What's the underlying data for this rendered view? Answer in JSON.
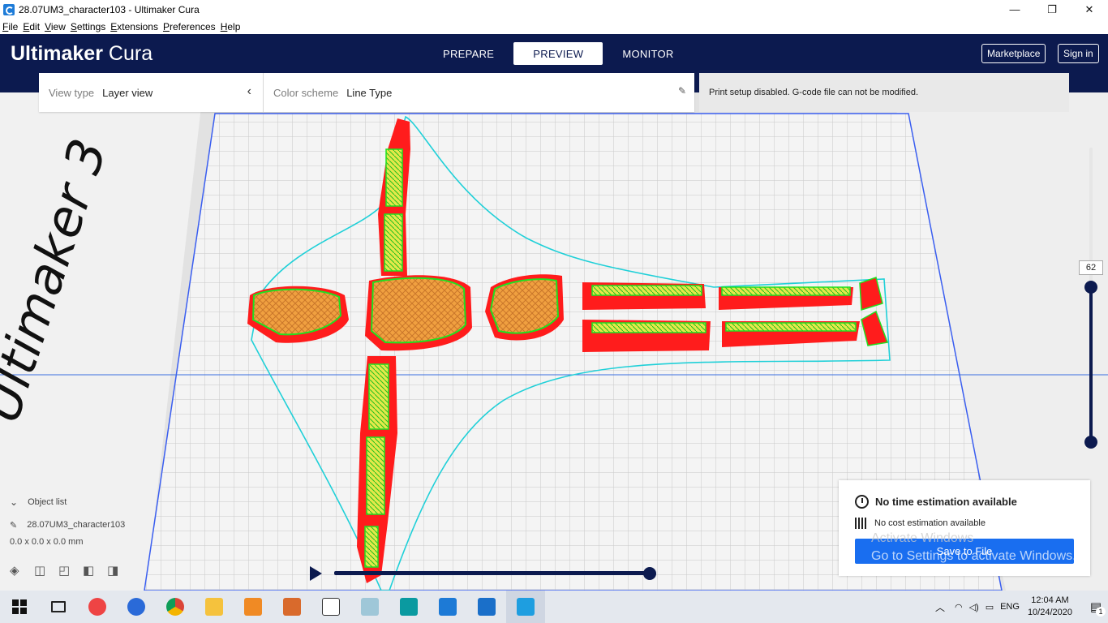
{
  "window": {
    "title": "28.07UM3_character103 - Ultimaker Cura",
    "controls": [
      "—",
      "❐",
      "✕"
    ]
  },
  "menu": [
    "File",
    "Edit",
    "View",
    "Settings",
    "Extensions",
    "Preferences",
    "Help"
  ],
  "header": {
    "logo_bold": "Ultimaker",
    "logo_light": "Cura",
    "tabs": [
      {
        "label": "PREPARE",
        "active": false
      },
      {
        "label": "PREVIEW",
        "active": true
      },
      {
        "label": "MONITOR",
        "active": false
      }
    ],
    "marketplace_label": "Marketplace",
    "signin_label": "Sign in"
  },
  "view_panel": {
    "view_type_label": "View type",
    "view_type_value": "Layer view",
    "color_scheme_label": "Color scheme",
    "color_scheme_value": "Line Type",
    "print_setup_message": "Print setup disabled. G-code file can not be modified."
  },
  "build_plate": {
    "printer_brand_text": "Ultimaker 3"
  },
  "object_panel": {
    "list_label": "Object list",
    "object_name": "28.07UM3_character103",
    "dimensions": "0.0 x 0.0 x 0.0 mm"
  },
  "layer_slider": {
    "current_layer": "62",
    "upper_fraction": 0.54,
    "lower_fraction": 0.0
  },
  "path_slider": {
    "fraction": 1.0
  },
  "estimation": {
    "time_text": "No time estimation available",
    "cost_text": "No cost estimation available",
    "save_label": "Save to File"
  },
  "watermark": {
    "line1": "Activate Windows",
    "line2": "Go to Settings to activate Windows."
  },
  "taskbar": {
    "language": "ENG",
    "time": "12:04 AM",
    "date": "10/24/2020",
    "notification_count": "1"
  },
  "colors": {
    "header_bg": "#0c1a4f",
    "save_button": "#196ef0",
    "wall": "#ff1c1c",
    "infill": "#f0a040",
    "inner_wall": "#20e020",
    "skirt": "#20d0d8"
  }
}
